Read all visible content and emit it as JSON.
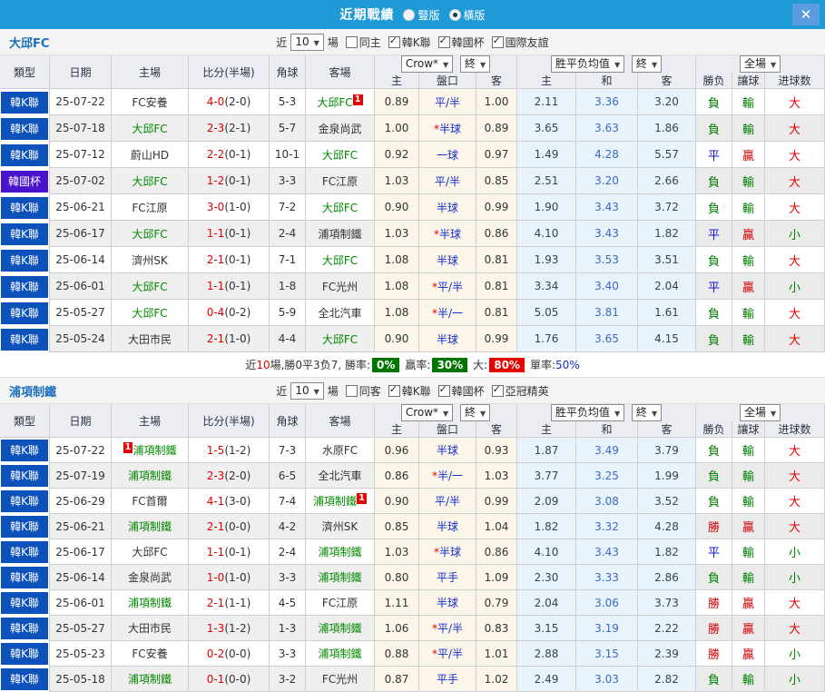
{
  "titlebar": {
    "title": "近期戰績",
    "radio_vertical": "豎版",
    "radio_vertical_selected": false,
    "radio_horizontal": "橫版",
    "radio_horizontal_selected": true
  },
  "icons": {
    "close": "✕",
    "dropdown_arrow": "▼",
    "check": "✓"
  },
  "colors": {
    "titlebar_bg": "#1e9ad6",
    "league_badge_bg": "#0d51bb",
    "cup_badge_bg": "#4a14cf",
    "team_highlight": "#008800",
    "score_red": "#e60000",
    "result_win": "#d40000",
    "result_lose": "#008000",
    "result_draw": "#1414d4"
  },
  "result_colors": {
    "勝": "#d40000",
    "負": "#008000",
    "平": "#1414d4",
    "贏": "#d40000",
    "輸": "#008000",
    "大": "#e60000",
    "小": "#008000"
  },
  "columns": {
    "type": "類型",
    "date": "日期",
    "home": "主場",
    "score": "比分(半場)",
    "corner": "角球",
    "away": "客場",
    "odds_home": "主",
    "odds_line": "盤口",
    "odds_away": "客",
    "avg_home": "主",
    "avg_draw": "和",
    "avg_away": "客",
    "result_wdl": "勝负",
    "result_handicap": "讓球",
    "result_goals": "进球数"
  },
  "dropdowns": {
    "crow": "Crow*",
    "final1": "終",
    "avg": "胜平负均值",
    "final2": "終",
    "fullmatch": "全場"
  },
  "sections": [
    {
      "team": "大邱FC",
      "filter": {
        "near_label": "近",
        "count": "10",
        "games_label": "場",
        "checkboxes": [
          {
            "label": "同主",
            "checked": false
          },
          {
            "label": "韓K聯",
            "checked": true
          },
          {
            "label": "韓國杯",
            "checked": true
          },
          {
            "label": "國際友誼",
            "checked": true
          }
        ]
      },
      "rows": [
        {
          "type": "韓K聯",
          "cup": false,
          "date": "25-07-22",
          "home": "FC安養",
          "home_green": false,
          "home_badge": "",
          "home_badge_pos": "",
          "score": "4-0",
          "half": "(2-0)",
          "corner": "5-3",
          "away": "大邱FC",
          "away_green": true,
          "away_badge": "1",
          "away_badge_pos": "after",
          "o_home": "0.89",
          "line": "平/半",
          "star": false,
          "o_away": "1.00",
          "a_home": "2.11",
          "a_draw": "3.36",
          "a_away": "3.20",
          "r1": "負",
          "r2": "輸",
          "r3": "大"
        },
        {
          "type": "韓K聯",
          "cup": false,
          "date": "25-07-18",
          "home": "大邱FC",
          "home_green": true,
          "home_badge": "",
          "home_badge_pos": "",
          "score": "2-3",
          "half": "(2-1)",
          "corner": "5-7",
          "away": "金泉尚武",
          "away_green": false,
          "away_badge": "",
          "away_badge_pos": "",
          "o_home": "1.00",
          "line": "半球",
          "star": true,
          "o_away": "0.89",
          "a_home": "3.65",
          "a_draw": "3.63",
          "a_away": "1.86",
          "r1": "負",
          "r2": "輸",
          "r3": "大"
        },
        {
          "type": "韓K聯",
          "cup": false,
          "date": "25-07-12",
          "home": "蔚山HD",
          "home_green": false,
          "home_badge": "",
          "home_badge_pos": "",
          "score": "2-2",
          "half": "(0-1)",
          "corner": "10-1",
          "away": "大邱FC",
          "away_green": true,
          "away_badge": "",
          "away_badge_pos": "",
          "o_home": "0.92",
          "line": "一球",
          "star": false,
          "o_away": "0.97",
          "a_home": "1.49",
          "a_draw": "4.28",
          "a_away": "5.57",
          "r1": "平",
          "r2": "贏",
          "r3": "大"
        },
        {
          "type": "韓國杯",
          "cup": true,
          "date": "25-07-02",
          "home": "大邱FC",
          "home_green": true,
          "home_badge": "",
          "home_badge_pos": "",
          "score": "1-2",
          "half": "(0-1)",
          "corner": "3-3",
          "away": "FC江原",
          "away_green": false,
          "away_badge": "",
          "away_badge_pos": "",
          "o_home": "1.03",
          "line": "平/半",
          "star": false,
          "o_away": "0.85",
          "a_home": "2.51",
          "a_draw": "3.20",
          "a_away": "2.66",
          "r1": "負",
          "r2": "輸",
          "r3": "大"
        },
        {
          "type": "韓K聯",
          "cup": false,
          "date": "25-06-21",
          "home": "FC江原",
          "home_green": false,
          "home_badge": "",
          "home_badge_pos": "",
          "score": "3-0",
          "half": "(1-0)",
          "corner": "7-2",
          "away": "大邱FC",
          "away_green": true,
          "away_badge": "",
          "away_badge_pos": "",
          "o_home": "0.90",
          "line": "半球",
          "star": false,
          "o_away": "0.99",
          "a_home": "1.90",
          "a_draw": "3.43",
          "a_away": "3.72",
          "r1": "負",
          "r2": "輸",
          "r3": "大"
        },
        {
          "type": "韓K聯",
          "cup": false,
          "date": "25-06-17",
          "home": "大邱FC",
          "home_green": true,
          "home_badge": "",
          "home_badge_pos": "",
          "score": "1-1",
          "half": "(0-1)",
          "corner": "2-4",
          "away": "浦項制鐵",
          "away_green": false,
          "away_badge": "",
          "away_badge_pos": "",
          "o_home": "1.03",
          "line": "半球",
          "star": true,
          "o_away": "0.86",
          "a_home": "4.10",
          "a_draw": "3.43",
          "a_away": "1.82",
          "r1": "平",
          "r2": "贏",
          "r3": "小"
        },
        {
          "type": "韓K聯",
          "cup": false,
          "date": "25-06-14",
          "home": "濟州SK",
          "home_green": false,
          "home_badge": "",
          "home_badge_pos": "",
          "score": "2-1",
          "half": "(0-1)",
          "corner": "7-1",
          "away": "大邱FC",
          "away_green": true,
          "away_badge": "",
          "away_badge_pos": "",
          "o_home": "1.08",
          "line": "半球",
          "star": false,
          "o_away": "0.81",
          "a_home": "1.93",
          "a_draw": "3.53",
          "a_away": "3.51",
          "r1": "負",
          "r2": "輸",
          "r3": "大"
        },
        {
          "type": "韓K聯",
          "cup": false,
          "date": "25-06-01",
          "home": "大邱FC",
          "home_green": true,
          "home_badge": "",
          "home_badge_pos": "",
          "score": "1-1",
          "half": "(0-1)",
          "corner": "1-8",
          "away": "FC光州",
          "away_green": false,
          "away_badge": "",
          "away_badge_pos": "",
          "o_home": "1.08",
          "line": "平/半",
          "star": true,
          "o_away": "0.81",
          "a_home": "3.34",
          "a_draw": "3.40",
          "a_away": "2.04",
          "r1": "平",
          "r2": "贏",
          "r3": "小"
        },
        {
          "type": "韓K聯",
          "cup": false,
          "date": "25-05-27",
          "home": "大邱FC",
          "home_green": true,
          "home_badge": "",
          "home_badge_pos": "",
          "score": "0-4",
          "half": "(0-2)",
          "corner": "5-9",
          "away": "全北汽車",
          "away_green": false,
          "away_badge": "",
          "away_badge_pos": "",
          "o_home": "1.08",
          "line": "半/一",
          "star": true,
          "o_away": "0.81",
          "a_home": "5.05",
          "a_draw": "3.81",
          "a_away": "1.61",
          "r1": "負",
          "r2": "輸",
          "r3": "大"
        },
        {
          "type": "韓K聯",
          "cup": false,
          "date": "25-05-24",
          "home": "大田市民",
          "home_green": false,
          "home_badge": "",
          "home_badge_pos": "",
          "score": "2-1",
          "half": "(1-0)",
          "corner": "4-4",
          "away": "大邱FC",
          "away_green": true,
          "away_badge": "",
          "away_badge_pos": "",
          "o_home": "0.90",
          "line": "半球",
          "star": false,
          "o_away": "0.99",
          "a_home": "1.76",
          "a_draw": "3.65",
          "a_away": "4.15",
          "r1": "負",
          "r2": "輸",
          "r3": "大"
        }
      ],
      "summary": {
        "near_label": "近",
        "near_count": "10",
        "tail": "場,勝0平3负7, 勝率:",
        "win_badge": "0%",
        "win_badge_color": "#007500",
        "mid1": "贏率:",
        "cover_badge": "30%",
        "cover_badge_color": "#007500",
        "mid2": "大:",
        "big_badge": "80%",
        "big_badge_color": "#e60000",
        "mid3": "單率:",
        "single_value": "50%"
      }
    },
    {
      "team": "浦項制鐵",
      "filter": {
        "near_label": "近",
        "count": "10",
        "games_label": "場",
        "checkboxes": [
          {
            "label": "同客",
            "checked": false
          },
          {
            "label": "韓K聯",
            "checked": true
          },
          {
            "label": "韓國杯",
            "checked": true
          },
          {
            "label": "亞冠精英",
            "checked": true
          }
        ]
      },
      "rows": [
        {
          "type": "韓K聯",
          "cup": false,
          "date": "25-07-22",
          "home": "浦項制鐵",
          "home_green": true,
          "home_badge": "1",
          "home_badge_pos": "before",
          "score": "1-5",
          "half": "(1-2)",
          "corner": "7-3",
          "away": "水原FC",
          "away_green": false,
          "away_badge": "",
          "away_badge_pos": "",
          "o_home": "0.96",
          "line": "半球",
          "star": false,
          "o_away": "0.93",
          "a_home": "1.87",
          "a_draw": "3.49",
          "a_away": "3.79",
          "r1": "負",
          "r2": "輸",
          "r3": "大"
        },
        {
          "type": "韓K聯",
          "cup": false,
          "date": "25-07-19",
          "home": "浦項制鐵",
          "home_green": true,
          "home_badge": "",
          "home_badge_pos": "",
          "score": "2-3",
          "half": "(2-0)",
          "corner": "6-5",
          "away": "全北汽車",
          "away_green": false,
          "away_badge": "",
          "away_badge_pos": "",
          "o_home": "0.86",
          "line": "半/一",
          "star": true,
          "o_away": "1.03",
          "a_home": "3.77",
          "a_draw": "3.25",
          "a_away": "1.99",
          "r1": "負",
          "r2": "輸",
          "r3": "大"
        },
        {
          "type": "韓K聯",
          "cup": false,
          "date": "25-06-29",
          "home": "FC首爾",
          "home_green": false,
          "home_badge": "",
          "home_badge_pos": "",
          "score": "4-1",
          "half": "(3-0)",
          "corner": "7-4",
          "away": "浦項制鐵",
          "away_green": true,
          "away_badge": "1",
          "away_badge_pos": "after",
          "o_home": "0.90",
          "line": "平/半",
          "star": false,
          "o_away": "0.99",
          "a_home": "2.09",
          "a_draw": "3.08",
          "a_away": "3.52",
          "r1": "負",
          "r2": "輸",
          "r3": "大"
        },
        {
          "type": "韓K聯",
          "cup": false,
          "date": "25-06-21",
          "home": "浦項制鐵",
          "home_green": true,
          "home_badge": "",
          "home_badge_pos": "",
          "score": "2-1",
          "half": "(0-0)",
          "corner": "4-2",
          "away": "濟州SK",
          "away_green": false,
          "away_badge": "",
          "away_badge_pos": "",
          "o_home": "0.85",
          "line": "半球",
          "star": false,
          "o_away": "1.04",
          "a_home": "1.82",
          "a_draw": "3.32",
          "a_away": "4.28",
          "r1": "勝",
          "r2": "贏",
          "r3": "大"
        },
        {
          "type": "韓K聯",
          "cup": false,
          "date": "25-06-17",
          "home": "大邱FC",
          "home_green": false,
          "home_badge": "",
          "home_badge_pos": "",
          "score": "1-1",
          "half": "(0-1)",
          "corner": "2-4",
          "away": "浦項制鐵",
          "away_green": true,
          "away_badge": "",
          "away_badge_pos": "",
          "o_home": "1.03",
          "line": "半球",
          "star": true,
          "o_away": "0.86",
          "a_home": "4.10",
          "a_draw": "3.43",
          "a_away": "1.82",
          "r1": "平",
          "r2": "輸",
          "r3": "小"
        },
        {
          "type": "韓K聯",
          "cup": false,
          "date": "25-06-14",
          "home": "金泉尚武",
          "home_green": false,
          "home_badge": "",
          "home_badge_pos": "",
          "score": "1-0",
          "half": "(1-0)",
          "corner": "3-3",
          "away": "浦項制鐵",
          "away_green": true,
          "away_badge": "",
          "away_badge_pos": "",
          "o_home": "0.80",
          "line": "平手",
          "star": false,
          "o_away": "1.09",
          "a_home": "2.30",
          "a_draw": "3.33",
          "a_away": "2.86",
          "r1": "負",
          "r2": "輸",
          "r3": "小"
        },
        {
          "type": "韓K聯",
          "cup": false,
          "date": "25-06-01",
          "home": "浦項制鐵",
          "home_green": true,
          "home_badge": "",
          "home_badge_pos": "",
          "score": "2-1",
          "half": "(1-1)",
          "corner": "4-5",
          "away": "FC江原",
          "away_green": false,
          "away_badge": "",
          "away_badge_pos": "",
          "o_home": "1.11",
          "line": "半球",
          "star": false,
          "o_away": "0.79",
          "a_home": "2.04",
          "a_draw": "3.06",
          "a_away": "3.73",
          "r1": "勝",
          "r2": "贏",
          "r3": "大"
        },
        {
          "type": "韓K聯",
          "cup": false,
          "date": "25-05-27",
          "home": "大田市民",
          "home_green": false,
          "home_badge": "",
          "home_badge_pos": "",
          "score": "1-3",
          "half": "(1-2)",
          "corner": "1-3",
          "away": "浦項制鐵",
          "away_green": true,
          "away_badge": "",
          "away_badge_pos": "",
          "o_home": "1.06",
          "line": "平/半",
          "star": true,
          "o_away": "0.83",
          "a_home": "3.15",
          "a_draw": "3.19",
          "a_away": "2.22",
          "r1": "勝",
          "r2": "贏",
          "r3": "大"
        },
        {
          "type": "韓K聯",
          "cup": false,
          "date": "25-05-23",
          "home": "FC安養",
          "home_green": false,
          "home_badge": "",
          "home_badge_pos": "",
          "score": "0-2",
          "half": "(0-0)",
          "corner": "3-3",
          "away": "浦項制鐵",
          "away_green": true,
          "away_badge": "",
          "away_badge_pos": "",
          "o_home": "0.88",
          "line": "平/半",
          "star": true,
          "o_away": "1.01",
          "a_home": "2.88",
          "a_draw": "3.15",
          "a_away": "2.39",
          "r1": "勝",
          "r2": "贏",
          "r3": "小"
        },
        {
          "type": "韓K聯",
          "cup": false,
          "date": "25-05-18",
          "home": "浦項制鐵",
          "home_green": true,
          "home_badge": "",
          "home_badge_pos": "",
          "score": "0-1",
          "half": "(0-0)",
          "corner": "3-2",
          "away": "FC光州",
          "away_green": false,
          "away_badge": "",
          "away_badge_pos": "",
          "o_home": "0.87",
          "line": "平手",
          "star": false,
          "o_away": "1.02",
          "a_home": "2.49",
          "a_draw": "3.03",
          "a_away": "2.82",
          "r1": "負",
          "r2": "輸",
          "r3": "小"
        }
      ],
      "summary": null
    }
  ]
}
